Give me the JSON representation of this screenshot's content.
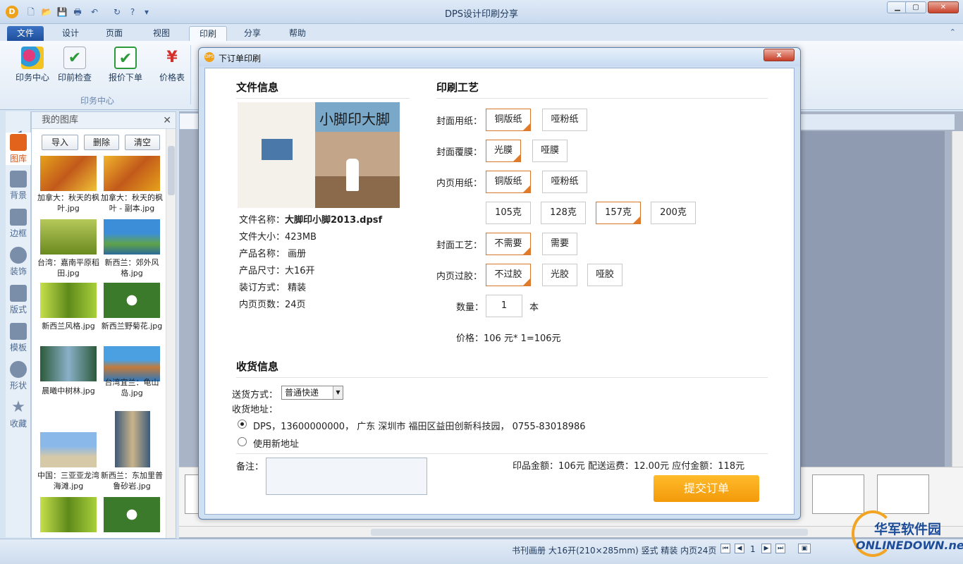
{
  "window": {
    "title": "DPS设计印刷分享",
    "min": "▁",
    "max": "▢",
    "close": "✕"
  },
  "tabs": [
    "文件",
    "设计",
    "页面",
    "视图",
    "印刷",
    "分享",
    "帮助"
  ],
  "ribbon": {
    "buttons": [
      "印务中心",
      "印前检查",
      "报价下单",
      "价格表"
    ],
    "group": "印务中心"
  },
  "left_strip": [
    "图库",
    "背景",
    "边框",
    "装饰",
    "版式",
    "模板",
    "形状",
    "收藏"
  ],
  "gallery": {
    "title": "我的图库",
    "buttons": [
      "导入",
      "删除",
      "清空"
    ],
    "items": [
      "加拿大：秋天的枫叶.jpg",
      "加拿大：秋天的枫叶 - 副本.jpg",
      "台湾：嘉南平原稻田.jpg",
      "新西兰：郊外风格.jpg",
      "新西兰风格.jpg",
      "新西兰野菊花.jpg",
      "晨曦中树林.jpg",
      "台湾宜兰：龟山岛.jpg",
      "中国：三亚亚龙湾海滩.jpg",
      "新西兰：东加里普鲁砂岩.jpg"
    ]
  },
  "status": {
    "info": "书刊画册  大16开(210×285mm)  竖式  精装  内页24页",
    "page": "1"
  },
  "watermark": {
    "cn": "华军软件园",
    "en": "ONLINEDOWN.net"
  },
  "dialog": {
    "title": "下订单印刷",
    "close": "x",
    "file_info": {
      "heading": "文件信息",
      "cover_title": "小脚印大脚",
      "rows": [
        {
          "label": "文件名称：",
          "value": "大脚印小脚2013.dpsf"
        },
        {
          "label": "文件大小：",
          "value": "423MB"
        },
        {
          "label": "产品名称：",
          "value": " 画册"
        },
        {
          "label": "产品尺寸：",
          "value": "大16开"
        },
        {
          "label": "装订方式：",
          "value": " 精装"
        },
        {
          "label": "内页页数：",
          "value": "24页"
        }
      ]
    },
    "process": {
      "heading": "印刷工艺",
      "cover_paper": {
        "label": "封面用纸：",
        "options": [
          "铜版纸",
          "哑粉纸"
        ]
      },
      "cover_film": {
        "label": "封面覆膜：",
        "options": [
          "光膜",
          "哑膜"
        ]
      },
      "inner_paper": {
        "label": "内页用纸：",
        "options": [
          "铜版纸",
          "哑粉纸"
        ]
      },
      "weights": [
        "105克",
        "128克",
        "157克",
        "200克"
      ],
      "cover_craft": {
        "label": "封面工艺：",
        "options": [
          "不需要",
          "需要"
        ]
      },
      "inner_glue": {
        "label": "内页过胶：",
        "options": [
          "不过胶",
          "光胶",
          "哑胶"
        ]
      },
      "quantity": {
        "label": "数量：",
        "value": "1",
        "unit": "本"
      },
      "price": "价格：106 元* 1=106元"
    },
    "shipping": {
      "heading": "收货信息",
      "method_label": "送货方式：",
      "method_value": "普通快递",
      "address_label": "收货地址：",
      "address_1": "DPS，13600000000， 广东 深圳市 福田区益田创新科技园， 0755-83018986",
      "address_2": "使用新地址"
    },
    "note_label": "备注：",
    "totals": "印品金额：106元 配送运费：12.00元 应付金额：118元",
    "submit": "提交订单"
  },
  "colors": {
    "accent": "#f39a0a",
    "selected_border": "#d9782a",
    "ribbon": "#dae6f4"
  }
}
